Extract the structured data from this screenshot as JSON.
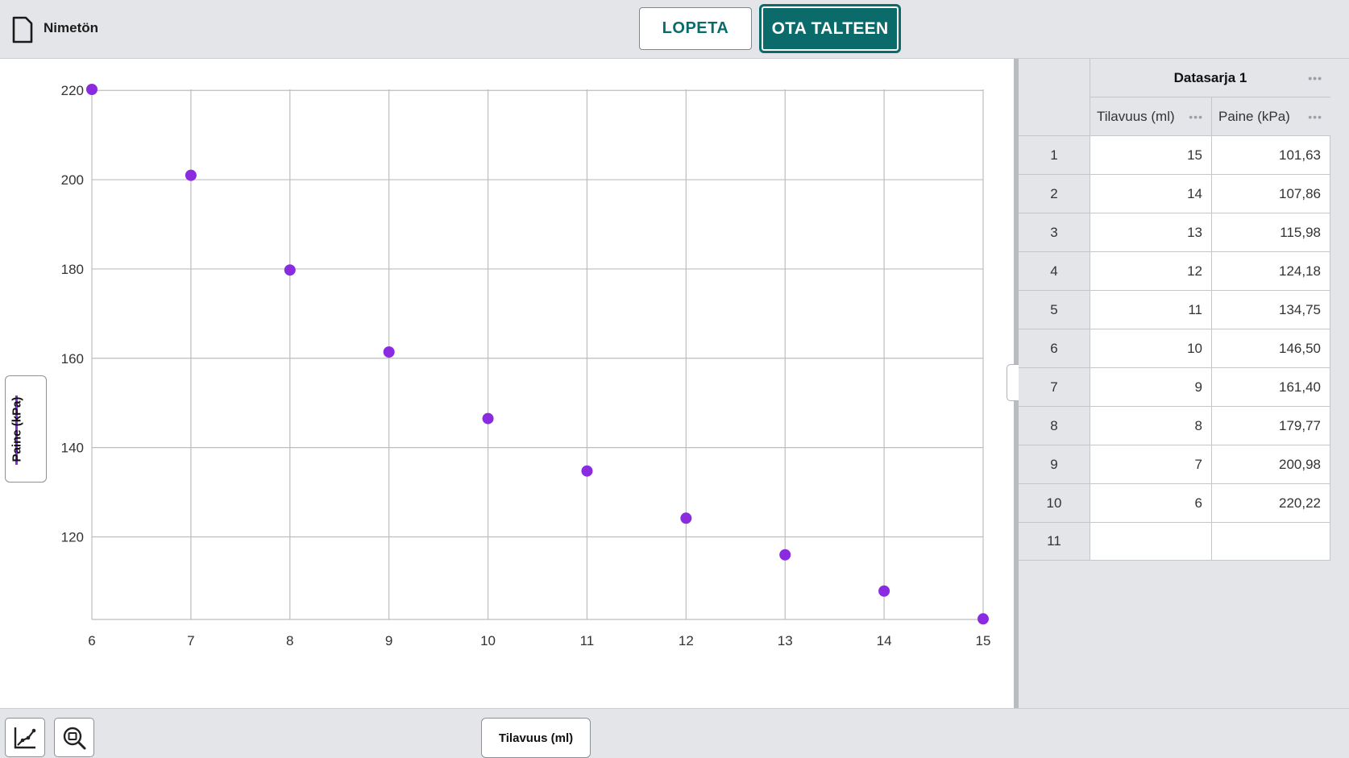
{
  "document": {
    "title": "Nimetön",
    "icon": "file-icon"
  },
  "toolbar": {
    "stop_label": "LOPETA",
    "collect_label": "OTA TALTEEN"
  },
  "graph": {
    "y_axis_button": "Paine (kPa)",
    "x_axis_button": "Tilavuus (ml)",
    "tools": [
      "graph-options-icon",
      "zoom-fit-icon"
    ]
  },
  "chart_data": {
    "type": "scatter",
    "series": [
      {
        "name": "Paine (kPa)",
        "color": "#8a2be2",
        "x": [
          15,
          14,
          13,
          12,
          11,
          10,
          9,
          8,
          7,
          6
        ],
        "y": [
          101.63,
          107.86,
          115.98,
          124.18,
          134.75,
          146.5,
          161.4,
          179.77,
          200.98,
          220.22
        ]
      }
    ],
    "xlim": [
      6,
      15
    ],
    "ylim": [
      101.5,
      220.22
    ],
    "x_ticks": [
      "6",
      "7",
      "8",
      "9",
      "10",
      "11",
      "12",
      "13",
      "14",
      "15"
    ],
    "y_ticks": [
      "120",
      "140",
      "160",
      "180",
      "200",
      "220"
    ],
    "grid": true
  },
  "table": {
    "series_title": "Datasarja 1",
    "columns": [
      "Tilavuus (ml)",
      "Paine (kPa)"
    ],
    "rows": [
      {
        "n": "1",
        "x": "15",
        "y": "101,63"
      },
      {
        "n": "2",
        "x": "14",
        "y": "107,86"
      },
      {
        "n": "3",
        "x": "13",
        "y": "115,98"
      },
      {
        "n": "4",
        "x": "12",
        "y": "124,18"
      },
      {
        "n": "5",
        "x": "11",
        "y": "134,75"
      },
      {
        "n": "6",
        "x": "10",
        "y": "146,50"
      },
      {
        "n": "7",
        "x": "9",
        "y": "161,40"
      },
      {
        "n": "8",
        "x": "8",
        "y": "179,77"
      },
      {
        "n": "9",
        "x": "7",
        "y": "200,98"
      },
      {
        "n": "10",
        "x": "6",
        "y": "220,22"
      },
      {
        "n": "11",
        "x": "",
        "y": ""
      }
    ]
  }
}
